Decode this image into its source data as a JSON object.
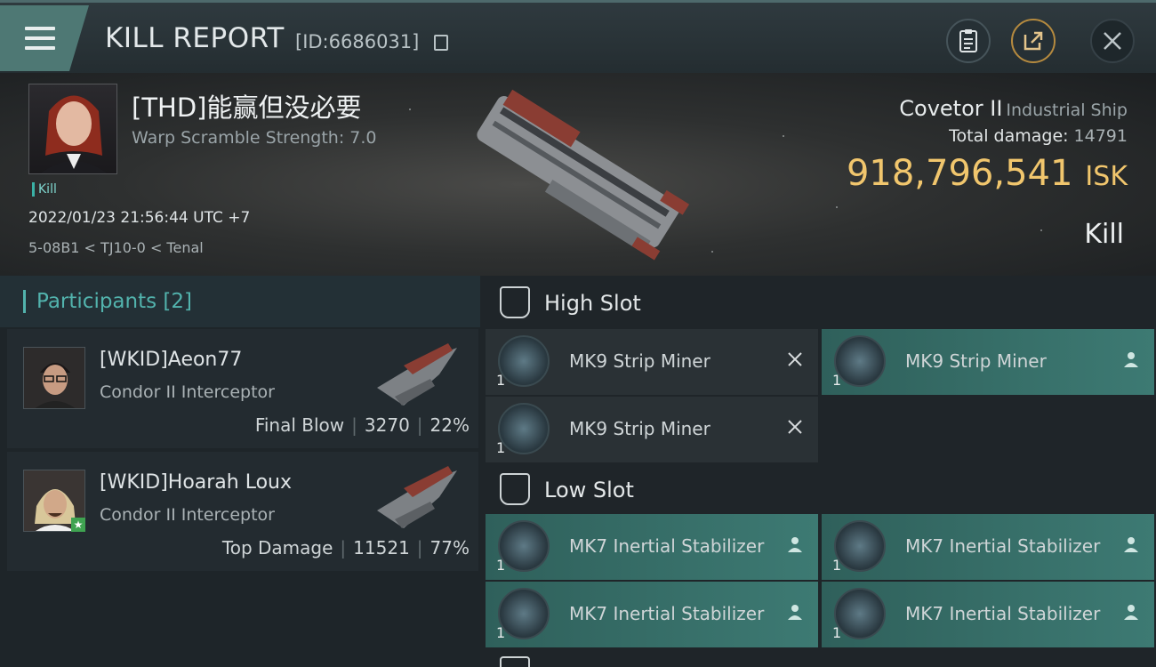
{
  "header": {
    "title": "KILL REPORT",
    "report_id": "[ID:6686031]",
    "actions": [
      "clipboard",
      "share",
      "close"
    ]
  },
  "victim": {
    "name": "[THD]能赢但没必要",
    "warp_scramble": "Warp Scramble Strength: 7.0",
    "tag": "Kill",
    "timestamp": "2022/01/23 21:56:44 UTC +7",
    "location": "5-08B1 < TJ10-0 < Tenal",
    "ship_name": "Covetor II",
    "ship_class": "Industrial Ship",
    "total_damage_label": "Total damage:",
    "total_damage_value": "14791",
    "isk_value": "918,796,541",
    "isk_unit": "ISK",
    "result": "Kill"
  },
  "participants": {
    "title": "Participants",
    "count": "[2]",
    "items": [
      {
        "name": "[WKID]Aeon77",
        "ship": "Condor II Interceptor",
        "role": "Final Blow",
        "damage": "3270",
        "percent": "22%"
      },
      {
        "name": "[WKID]Hoarah Loux",
        "ship": "Condor II Interceptor",
        "role": "Top Damage",
        "damage": "11521",
        "percent": "77%"
      }
    ]
  },
  "slots": {
    "high": {
      "label": "High Slot",
      "modules": [
        {
          "name": "MK9 Strip Miner",
          "qty": "1",
          "status": "destroyed"
        },
        {
          "name": "MK9 Strip Miner",
          "qty": "1",
          "status": "dropped"
        },
        {
          "name": "MK9 Strip Miner",
          "qty": "1",
          "status": "destroyed"
        }
      ]
    },
    "low": {
      "label": "Low Slot",
      "modules": [
        {
          "name": "MK7 Inertial Stabilizer",
          "qty": "1",
          "status": "dropped"
        },
        {
          "name": "MK7 Inertial Stabilizer",
          "qty": "1",
          "status": "dropped"
        },
        {
          "name": "MK7 Inertial Stabilizer",
          "qty": "1",
          "status": "dropped"
        },
        {
          "name": "MK7 Inertial Stabilizer",
          "qty": "1",
          "status": "dropped"
        }
      ]
    }
  },
  "colors": {
    "accent_teal": "#52b3ad",
    "isk_gold": "#f1c66d",
    "dropped_bg": "#3d7a73",
    "destroyed_bg": "#2a3135"
  }
}
